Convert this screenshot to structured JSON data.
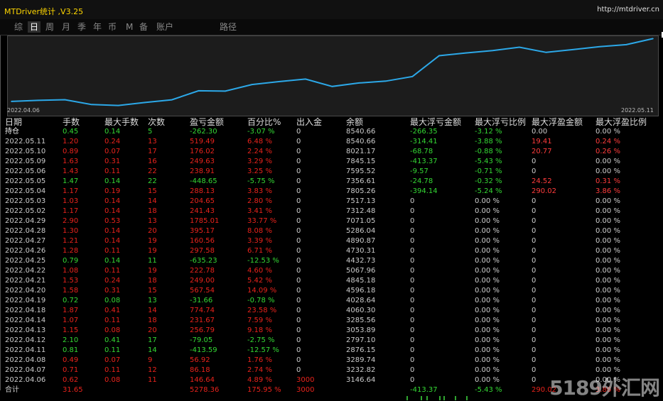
{
  "app": {
    "title": "MTDriver统计 ,V3.25",
    "link": "http://mtdriver.cn"
  },
  "tabs": [
    "综",
    "日",
    "周",
    "月",
    "季",
    "年",
    "币",
    "M",
    "备",
    "账户",
    "路径"
  ],
  "active_tab": 1,
  "colors": {
    "loss": "#e8231c",
    "profit": "#34d834",
    "curve": "#2ca8e8",
    "title": "#ffd700"
  },
  "chart": {
    "date_start": "2022.04.06",
    "date_end": "2022.05.11",
    "chart_data": {
      "type": "line",
      "series": [
        {
          "values": [
            3146.64,
            3232.82,
            3289.74,
            2876.15,
            2797.1,
            3053.89,
            3285.56,
            4060.3,
            4028.64,
            4596.18,
            4845.18,
            5067.96,
            4432.73,
            4730.31,
            4890.87,
            5286.04,
            7071.05,
            7312.48,
            7517.13,
            7805.26,
            7356.61,
            7595.52,
            7845.15,
            8021.17,
            8540.66
          ]
        }
      ],
      "x": [
        "2022.04.06",
        "2022.04.07",
        "2022.04.08",
        "2022.04.11",
        "2022.04.12",
        "2022.04.13",
        "2022.04.14",
        "2022.04.18",
        "2022.04.19",
        "2022.04.20",
        "2022.04.21",
        "2022.04.22",
        "2022.04.25",
        "2022.04.26",
        "2022.04.27",
        "2022.04.28",
        "2022.04.29",
        "2022.05.02",
        "2022.05.03",
        "2022.05.04",
        "2022.05.05",
        "2022.05.06",
        "2022.05.09",
        "2022.05.10",
        "2022.05.11"
      ],
      "ylim": [
        2650,
        8750
      ]
    }
  },
  "table": {
    "headers": [
      "日期",
      "手数",
      "最大手数",
      "次数",
      "盈亏金额",
      "百分比%",
      "出入金",
      "余额",
      "最大浮亏金额",
      "最大浮亏比例",
      "最大浮盈金额",
      "最大浮盈比例"
    ],
    "rows": [
      {
        "t": "hold",
        "cells": [
          "持仓",
          "0.45",
          "0.14",
          "5",
          "-262.30",
          "-3.07 %",
          "0",
          "8540.66",
          "-266.35",
          "-3.12 %",
          "0.00",
          "0.00 %"
        ]
      },
      {
        "t": "r",
        "cells": [
          "2022.05.11",
          "1.20",
          "0.24",
          "13",
          "519.49",
          "6.48 %",
          "0",
          "8540.66",
          "-314.41",
          "-3.88 %",
          "19.41",
          "0.24 %"
        ]
      },
      {
        "t": "r",
        "cells": [
          "2022.05.10",
          "0.89",
          "0.07",
          "17",
          "176.02",
          "2.24 %",
          "0",
          "8021.17",
          "-68.78",
          "-0.88 %",
          "20.77",
          "0.26 %"
        ]
      },
      {
        "t": "r",
        "cells": [
          "2022.05.09",
          "1.63",
          "0.31",
          "16",
          "249.63",
          "3.29 %",
          "0",
          "7845.15",
          "-413.37",
          "-5.43 %",
          "0",
          "0.00 %"
        ]
      },
      {
        "t": "r",
        "cells": [
          "2022.05.06",
          "1.43",
          "0.11",
          "22",
          "238.91",
          "3.25 %",
          "0",
          "7595.52",
          "-9.57",
          "-0.71 %",
          "0",
          "0.00 %"
        ]
      },
      {
        "t": "g",
        "cells": [
          "2022.05.05",
          "1.47",
          "0.14",
          "22",
          "-448.65",
          "-5.75 %",
          "0",
          "7356.61",
          "-24.78",
          "-0.32 %",
          "24.52",
          "0.31 %"
        ]
      },
      {
        "t": "r",
        "cells": [
          "2022.05.04",
          "1.17",
          "0.19",
          "15",
          "288.13",
          "3.83 %",
          "0",
          "7805.26",
          "-394.14",
          "-5.24 %",
          "290.02",
          "3.86 %"
        ]
      },
      {
        "t": "r",
        "cells": [
          "2022.05.03",
          "1.03",
          "0.14",
          "14",
          "204.65",
          "2.80 %",
          "0",
          "7517.13",
          "0",
          "0.00 %",
          "0",
          "0.00 %"
        ]
      },
      {
        "t": "r",
        "cells": [
          "2022.05.02",
          "1.17",
          "0.14",
          "18",
          "241.43",
          "3.41 %",
          "0",
          "7312.48",
          "0",
          "0.00 %",
          "0",
          "0.00 %"
        ]
      },
      {
        "t": "r",
        "cells": [
          "2022.04.29",
          "2.90",
          "0.53",
          "13",
          "1785.01",
          "33.77 %",
          "0",
          "7071.05",
          "0",
          "0.00 %",
          "0",
          "0.00 %"
        ]
      },
      {
        "t": "r",
        "cells": [
          "2022.04.28",
          "1.30",
          "0.14",
          "20",
          "395.17",
          "8.08 %",
          "0",
          "5286.04",
          "0",
          "0.00 %",
          "0",
          "0.00 %"
        ]
      },
      {
        "t": "r",
        "cells": [
          "2022.04.27",
          "1.21",
          "0.14",
          "19",
          "160.56",
          "3.39 %",
          "0",
          "4890.87",
          "0",
          "0.00 %",
          "0",
          "0.00 %"
        ]
      },
      {
        "t": "r",
        "cells": [
          "2022.04.26",
          "1.28",
          "0.11",
          "19",
          "297.58",
          "6.71 %",
          "0",
          "4730.31",
          "0",
          "0.00 %",
          "0",
          "0.00 %"
        ]
      },
      {
        "t": "g",
        "cells": [
          "2022.04.25",
          "0.79",
          "0.14",
          "11",
          "-635.23",
          "-12.53 %",
          "0",
          "4432.73",
          "0",
          "0.00 %",
          "0",
          "0.00 %"
        ]
      },
      {
        "t": "r",
        "cells": [
          "2022.04.22",
          "1.08",
          "0.11",
          "19",
          "222.78",
          "4.60 %",
          "0",
          "5067.96",
          "0",
          "0.00 %",
          "0",
          "0.00 %"
        ]
      },
      {
        "t": "r",
        "cells": [
          "2022.04.21",
          "1.53",
          "0.24",
          "18",
          "249.00",
          "5.42 %",
          "0",
          "4845.18",
          "0",
          "0.00 %",
          "0",
          "0.00 %"
        ]
      },
      {
        "t": "r",
        "cells": [
          "2022.04.20",
          "1.58",
          "0.31",
          "15",
          "567.54",
          "14.09 %",
          "0",
          "4596.18",
          "0",
          "0.00 %",
          "0",
          "0.00 %"
        ]
      },
      {
        "t": "g",
        "cells": [
          "2022.04.19",
          "0.72",
          "0.08",
          "13",
          "-31.66",
          "-0.78 %",
          "0",
          "4028.64",
          "0",
          "0.00 %",
          "0",
          "0.00 %"
        ]
      },
      {
        "t": "r",
        "cells": [
          "2022.04.18",
          "1.87",
          "0.41",
          "14",
          "774.74",
          "23.58 %",
          "0",
          "4060.30",
          "0",
          "0.00 %",
          "0",
          "0.00 %"
        ]
      },
      {
        "t": "r",
        "cells": [
          "2022.04.14",
          "1.07",
          "0.11",
          "18",
          "231.67",
          "7.59 %",
          "0",
          "3285.56",
          "0",
          "0.00 %",
          "0",
          "0.00 %"
        ]
      },
      {
        "t": "r",
        "cells": [
          "2022.04.13",
          "1.15",
          "0.08",
          "20",
          "256.79",
          "9.18 %",
          "0",
          "3053.89",
          "0",
          "0.00 %",
          "0",
          "0.00 %"
        ]
      },
      {
        "t": "g",
        "cells": [
          "2022.04.12",
          "2.10",
          "0.41",
          "17",
          "-79.05",
          "-2.75 %",
          "0",
          "2797.10",
          "0",
          "0.00 %",
          "0",
          "0.00 %"
        ]
      },
      {
        "t": "g",
        "cells": [
          "2022.04.11",
          "0.81",
          "0.11",
          "14",
          "-413.59",
          "-12.57 %",
          "0",
          "2876.15",
          "0",
          "0.00 %",
          "0",
          "0.00 %"
        ]
      },
      {
        "t": "r",
        "cells": [
          "2022.04.08",
          "0.49",
          "0.07",
          "9",
          "56.92",
          "1.76 %",
          "0",
          "3289.74",
          "0",
          "0.00 %",
          "0",
          "0.00 %"
        ]
      },
      {
        "t": "r",
        "cells": [
          "2022.04.07",
          "0.71",
          "0.11",
          "12",
          "86.18",
          "2.74 %",
          "0",
          "3232.82",
          "0",
          "0.00 %",
          "0",
          "0.00 %"
        ]
      },
      {
        "t": "r",
        "cells": [
          "2022.04.06",
          "0.62",
          "0.08",
          "11",
          "146.64",
          "4.89 %",
          "3000",
          "3146.64",
          "0",
          "0.00 %",
          "0",
          "0.00 %"
        ]
      }
    ],
    "total": [
      "合计",
      "31.65",
      "",
      "",
      "5278.36",
      "175.95 %",
      "3000",
      "",
      "-413.37",
      "-5.43 %",
      "290.02",
      "3.86 %"
    ]
  },
  "watermark": "5189外汇网"
}
